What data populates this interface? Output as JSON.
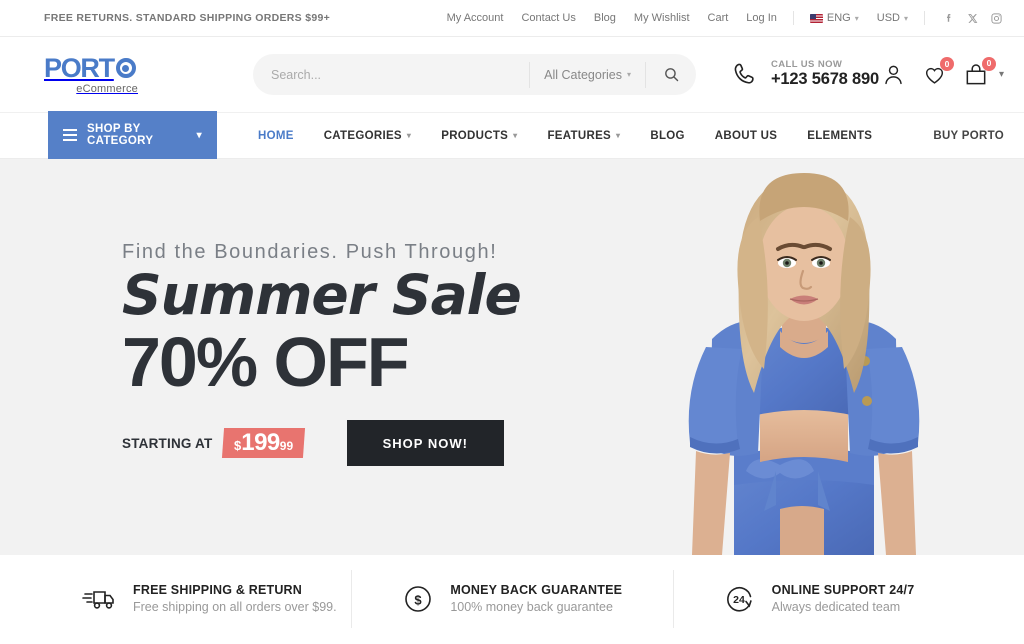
{
  "topbar": {
    "promo": "FREE RETURNS. STANDARD SHIPPING ORDERS $99+",
    "links": [
      {
        "label": "My Account"
      },
      {
        "label": "Contact Us"
      },
      {
        "label": "Blog"
      },
      {
        "label": "My Wishlist"
      },
      {
        "label": "Cart"
      },
      {
        "label": "Log In"
      }
    ],
    "language": "ENG",
    "currency": "USD",
    "social": [
      {
        "name": "facebook-icon",
        "glyph": "f"
      },
      {
        "name": "x-twitter-icon",
        "glyph": "✕"
      },
      {
        "name": "instagram-icon",
        "glyph": "▢"
      }
    ]
  },
  "header": {
    "logo_main": "PORT",
    "logo_sub": "eCommerce",
    "search": {
      "placeholder": "Search...",
      "value": "",
      "category": "All Categories"
    },
    "phone_label": "CALL US NOW",
    "phone_number": "+123 5678 890",
    "wishlist_count": "0",
    "cart_count": "0"
  },
  "nav": {
    "shop_by_category": "SHOP BY CATEGORY",
    "items": [
      {
        "label": "HOME",
        "caret": false,
        "active": true
      },
      {
        "label": "CATEGORIES",
        "caret": true,
        "active": false
      },
      {
        "label": "PRODUCTS",
        "caret": true,
        "active": false
      },
      {
        "label": "FEATURES",
        "caret": true,
        "active": false
      },
      {
        "label": "BLOG",
        "caret": false,
        "active": false
      },
      {
        "label": "ABOUT US",
        "caret": false,
        "active": false
      },
      {
        "label": "ELEMENTS",
        "caret": false,
        "active": false
      }
    ],
    "buy_porto": "BUY PORTO"
  },
  "hero": {
    "subtitle": "Find the Boundaries. Push Through!",
    "script_title": "Summer Sale",
    "discount": "70% OFF",
    "starting_at": "STARTING AT",
    "price_currency": "$",
    "price_amount": "199",
    "price_cents": "99",
    "cta": "SHOP NOW!",
    "background_color": "#f2f2f2",
    "outfit_color": "#5578c8"
  },
  "features": [
    {
      "icon": "delivery-truck-icon",
      "title": "FREE SHIPPING & RETURN",
      "desc": "Free shipping on all orders over $99."
    },
    {
      "icon": "dollar-coin-icon",
      "title": "MONEY BACK GUARANTEE",
      "desc": "100% money back guarantee"
    },
    {
      "icon": "support-24-icon",
      "title": "ONLINE SUPPORT 24/7",
      "desc": "Always dedicated team"
    }
  ],
  "colors": {
    "brand_blue": "#4a7bc8",
    "nav_blue": "#5580c8",
    "badge_red": "#ef6b6b",
    "price_coral": "#e8746f",
    "dark": "#222529"
  }
}
